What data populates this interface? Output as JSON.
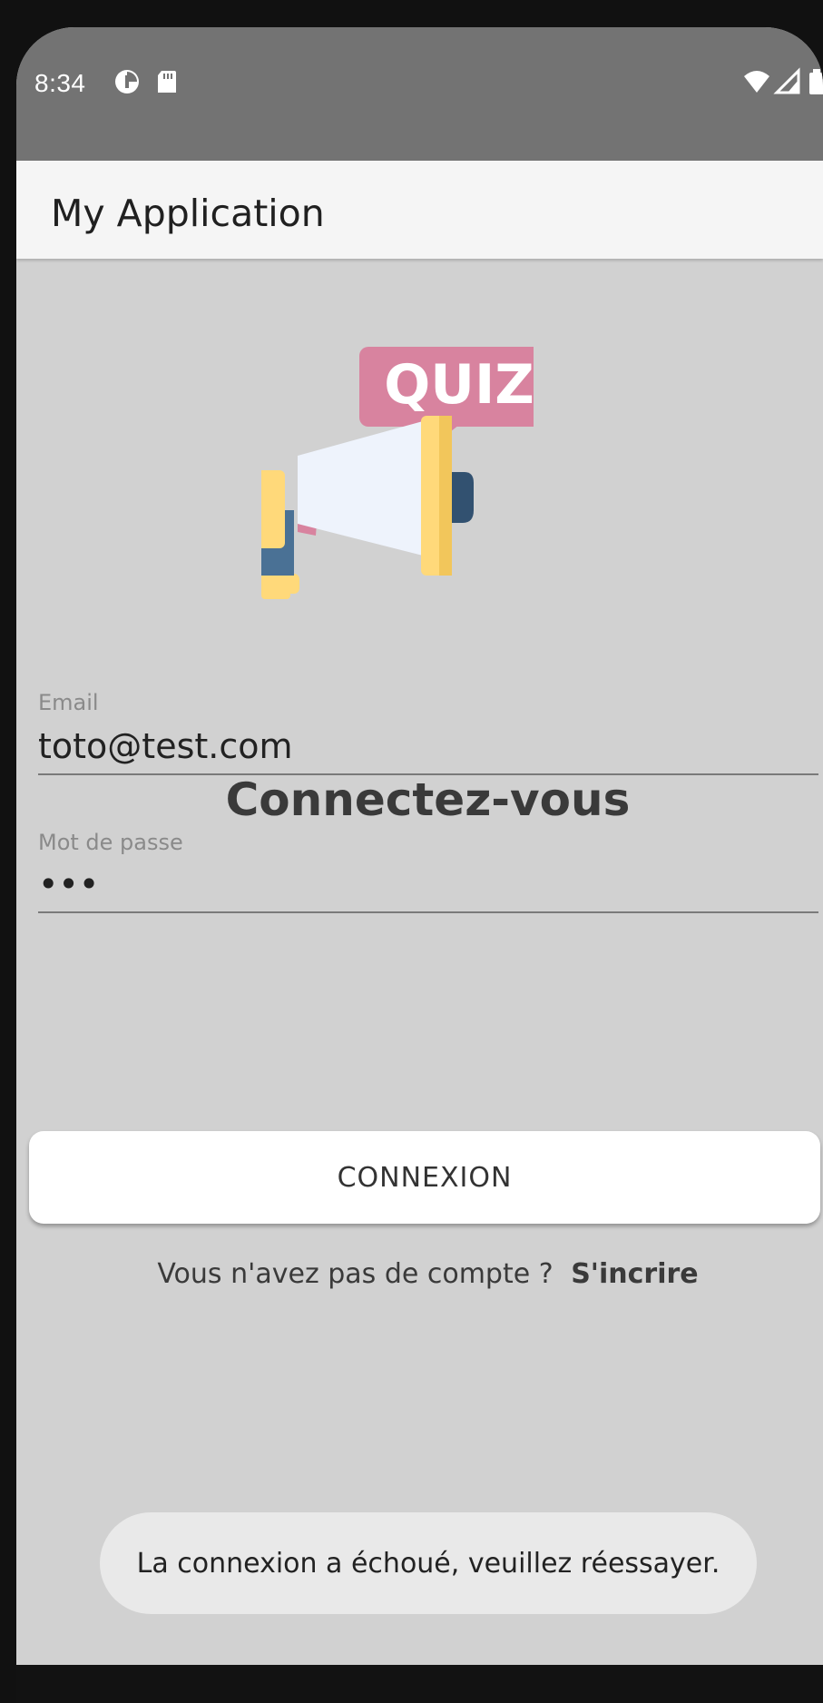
{
  "status_bar": {
    "time": "8:34",
    "icons": [
      "data-saver-icon",
      "sd-card-icon",
      "wifi-icon",
      "signal-icon",
      "battery-icon"
    ]
  },
  "app_bar": {
    "title": "My Application"
  },
  "logo": {
    "bubble_text": "QUIZ",
    "colors": {
      "bubble": "#d8839f",
      "horn": "#eef3fc",
      "rim": "#ffd97a",
      "handle": "#4a7195",
      "back": "#325170"
    }
  },
  "login": {
    "heading": "Connectez-vous",
    "email_label": "Email",
    "email_value": "toto@test.com",
    "password_label": "Mot de passe",
    "password_value": "•••",
    "submit_label": "CONNEXION",
    "no_account_text": "Vous n'avez pas de compte ?",
    "signup_link": "S'incrire"
  },
  "toast": {
    "message": "La connexion a échoué, veuillez réessayer."
  },
  "colors": {
    "background": "#d1d1d1",
    "status_bar": "#737373",
    "app_bar": "#f5f5f5",
    "button": "#ffffff",
    "toast": "#e9e9e9"
  }
}
